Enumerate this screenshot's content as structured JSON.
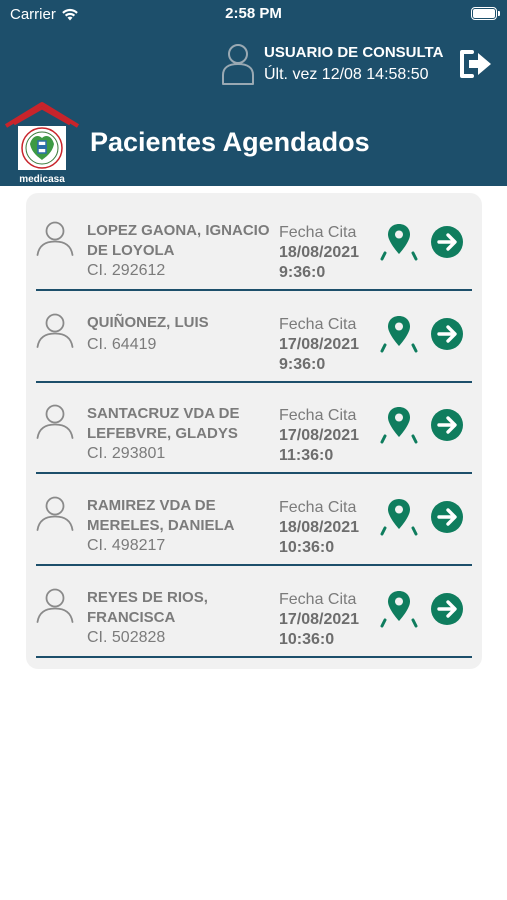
{
  "status_bar": {
    "carrier": "Carrier",
    "time": "2:58 PM",
    "battery": 1.0
  },
  "user": {
    "name": "USUARIO DE CONSULTA",
    "last_access": "Últ. vez 12/08 14:58:50"
  },
  "app": {
    "logo_text": "medicasa",
    "title": "Pacientes Agendados"
  },
  "colors": {
    "header": "#1d4f6b",
    "accent": "#0f7d5e",
    "text_muted": "#7b7b7b",
    "card_bg": "#f1f1f1"
  },
  "appointment_label": "Fecha Cita",
  "patients": [
    {
      "name": "LOPEZ GAONA, IGNACIO DE LOYOLA",
      "ci": "CI. 292612",
      "date": "18/08/2021",
      "time": "9:36:0"
    },
    {
      "name": "QUIÑONEZ, LUIS",
      "ci": "CI. 64419",
      "date": "17/08/2021",
      "time": "9:36:0"
    },
    {
      "name": "SANTACRUZ VDA DE LEFEBVRE, GLADYS",
      "ci": "CI. 293801",
      "date": "17/08/2021",
      "time": "11:36:0"
    },
    {
      "name": "RAMIREZ VDA DE MERELES, DANIELA",
      "ci": "CI. 498217",
      "date": "18/08/2021",
      "time": "10:36:0"
    },
    {
      "name": "REYES DE RIOS, FRANCISCA",
      "ci": "CI. 502828",
      "date": "17/08/2021",
      "time": "10:36:0"
    }
  ],
  "icons": {
    "user": "user-icon",
    "logout": "logout-icon",
    "person": "person-icon",
    "map": "map-pin-icon",
    "go": "arrow-right-circle-icon",
    "wifi": "wifi-icon",
    "battery": "battery-icon"
  }
}
